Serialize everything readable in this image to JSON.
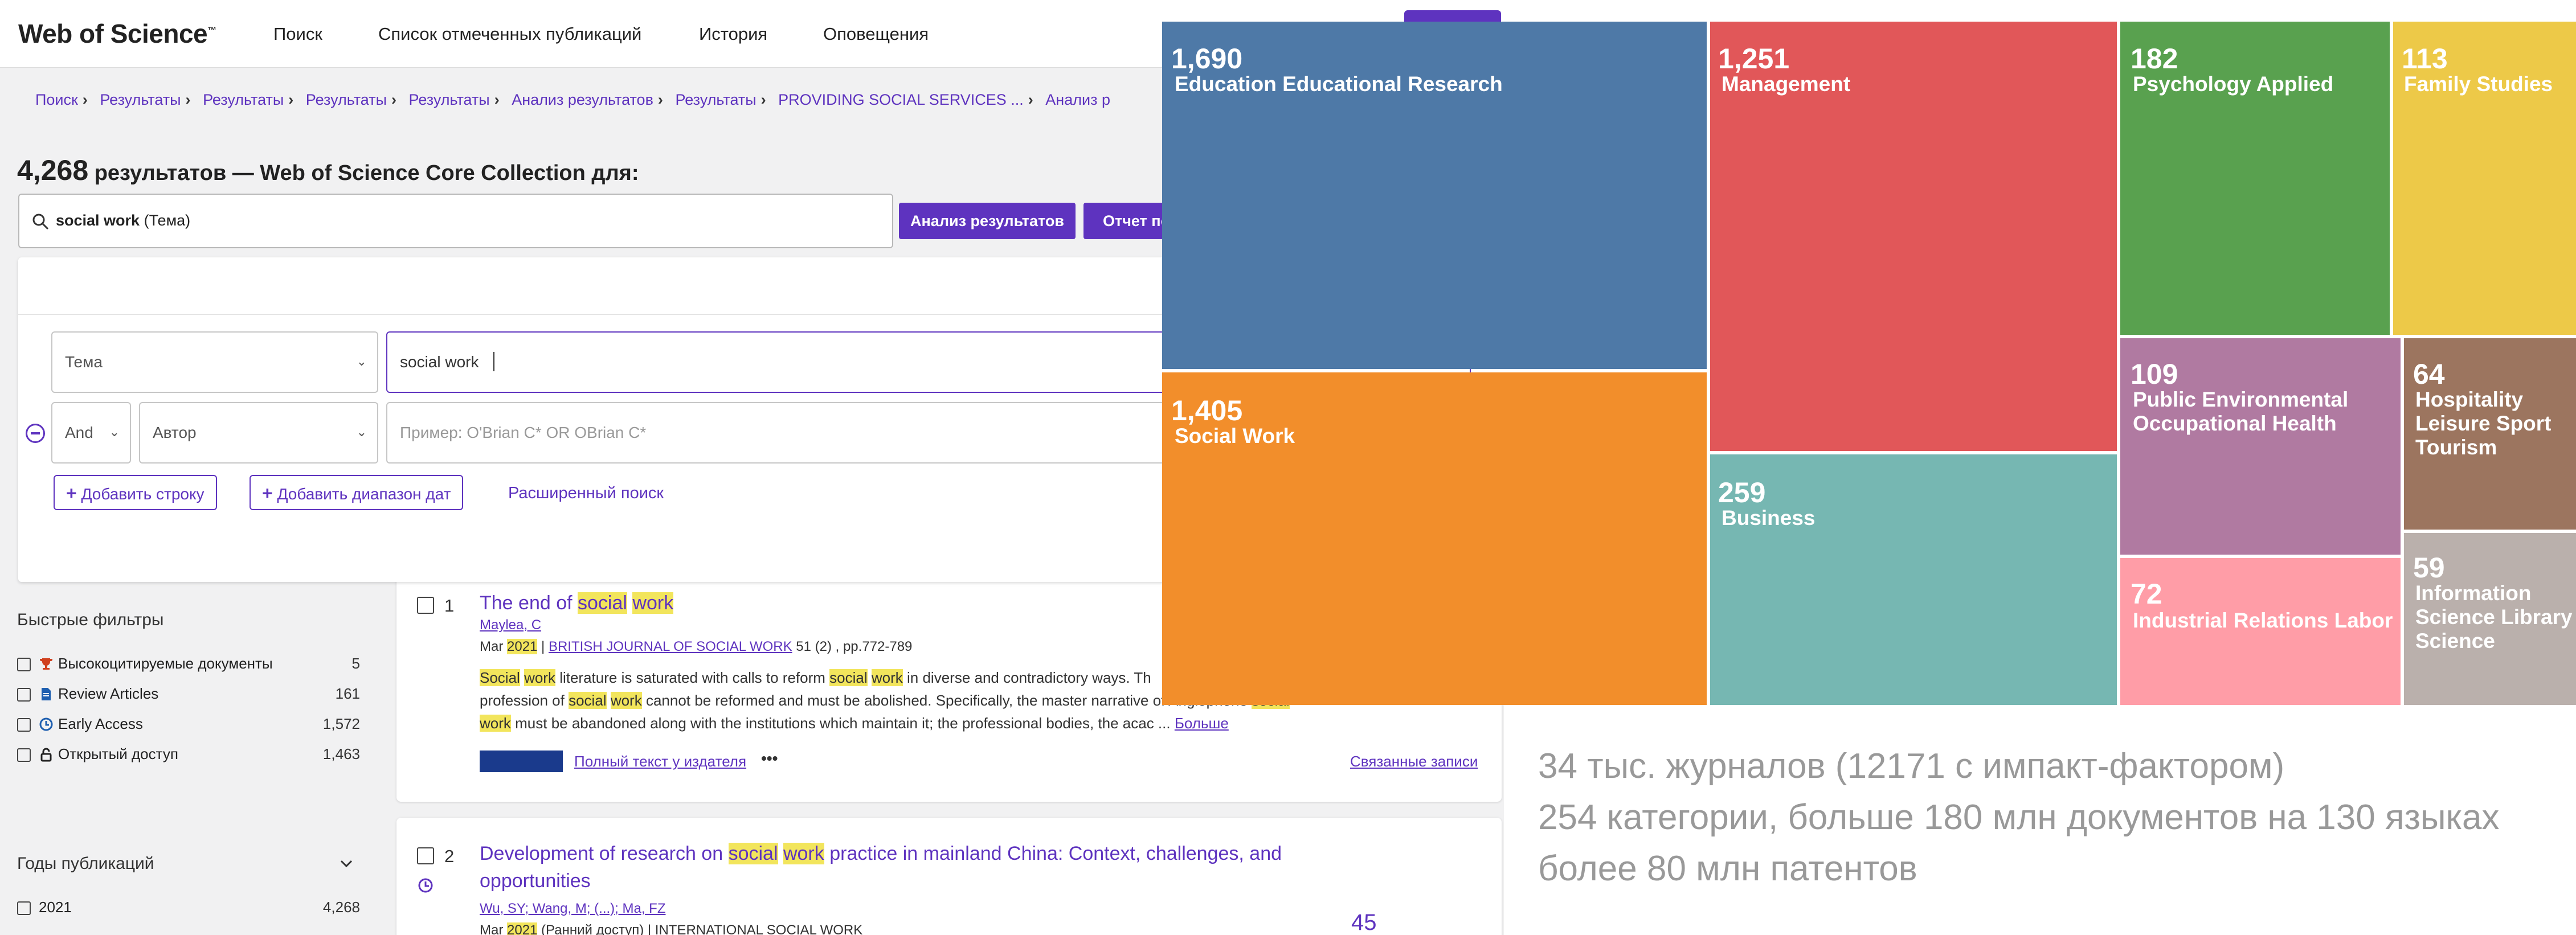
{
  "header": {
    "logo": "Web of Science",
    "nav": [
      "Поиск",
      "Список отмеченных публикаций",
      "История",
      "Оповещения"
    ]
  },
  "breadcrumb": [
    "Поиск",
    "Результаты",
    "Результаты",
    "Результаты",
    "Результаты",
    "Анализ результатов",
    "Результаты",
    "PROVIDING SOCIAL SERVICES ...",
    "Анализ р"
  ],
  "results": {
    "count": "4,268",
    "heading": "результатов — Web of Science Core Collection для:"
  },
  "search": {
    "query": "social work",
    "field": "(Тема)",
    "analyze_label": "Анализ результатов",
    "report_label": "Отчет по"
  },
  "builder": {
    "row1_field": "Тема",
    "row1_value": "social work",
    "row2_bool": "And",
    "row2_field": "Автор",
    "row2_placeholder": "Пример: O'Brian C* OR OBrian C*",
    "add_row": "Добавить строку",
    "add_date": "Добавить диапазон дат",
    "advanced": "Расширенный поиск"
  },
  "filters": {
    "quick_title": "Быстрые фильтры",
    "items": [
      {
        "label": "Высокоцитируемые документы",
        "count": "5"
      },
      {
        "label": "Review Articles",
        "count": "161"
      },
      {
        "label": "Early Access",
        "count": "1,572"
      },
      {
        "label": "Открытый доступ",
        "count": "1,463"
      }
    ],
    "years_title": "Годы публикаций",
    "years": [
      {
        "label": "2021",
        "count": "4,268"
      }
    ]
  },
  "records": [
    {
      "num": "1",
      "title_parts": [
        "The end of ",
        "social",
        " ",
        "work",
        ""
      ],
      "authors": "Maylea, C",
      "date_pre": "Mar ",
      "year": "2021",
      "journal": "BRITISH JOURNAL OF SOCIAL WORK",
      "vol": "51 (2) , pp.772-789",
      "abs1_a": "Social",
      "abs1_b": " ",
      "abs1_c": "work",
      "abs1_d": " literature is saturated with calls to reform ",
      "abs1_e": "social",
      "abs1_f": " ",
      "abs1_g": "work",
      "abs1_h": " in diverse and contradictory ways. Th",
      "abs2_a": "profession of ",
      "abs2_b": "social",
      "abs2_c": " ",
      "abs2_d": "work",
      "abs2_e": " cannot be reformed and must be abolished. Specifically, the master narrative of Anglophone ",
      "abs2_f": "social",
      "abs3_a": "work",
      "abs3_b": " must be abandoned along with the institutions which maintain it; the professional bodies, the acac ... ",
      "more": "Больше",
      "fulltext": "Полный текст у издателя",
      "dots": "•••",
      "related": "Связанные записи"
    },
    {
      "num": "2",
      "title_l1a": "Development of research on ",
      "title_l1b": "social",
      "title_l1c": " ",
      "title_l1d": "work",
      "title_l1e": " practice in mainland China: Context, challenges, and",
      "title_l2": "opportunities",
      "authors": "Wu, SY; Wang, M; (...); Ma, FZ",
      "date_pre": "Mar ",
      "year": "2021",
      "date_post": " (Ранний доступ) | INTERNATIONAL SOCIAL WORK",
      "citations": "45"
    }
  ],
  "treemap": {
    "cells": [
      {
        "value": "1,690",
        "label": "Education Educational Research",
        "color": "#4e79a7"
      },
      {
        "value": "1,405",
        "label": "Social Work",
        "color": "#f28e2b"
      },
      {
        "value": "1,251",
        "label": "Management",
        "color": "#e15759"
      },
      {
        "value": "259",
        "label": "Business",
        "color": "#76b7b2"
      },
      {
        "value": "182",
        "label": "Psychology Applied",
        "color": "#59a14f"
      },
      {
        "value": "113",
        "label": "Family Studies",
        "color": "#edc948"
      },
      {
        "value": "109",
        "label": "Public Environmental Occupational Health",
        "color": "#b07aa1"
      },
      {
        "value": "64",
        "label": "Hospitality Leisure Sport Tourism",
        "color": "#9c755f"
      },
      {
        "value": "72",
        "label": "Industrial Relations Labor",
        "color": "#ff9da7"
      },
      {
        "value": "59",
        "label": "Information Science Library Science",
        "color": "#bab0ac"
      }
    ]
  },
  "caption": [
    "34 тыс. журналов (12171 с импакт-фактором)",
    "254 категории, больше 180 млн документов на 130 языках",
    "более 80 млн патентов"
  ]
}
